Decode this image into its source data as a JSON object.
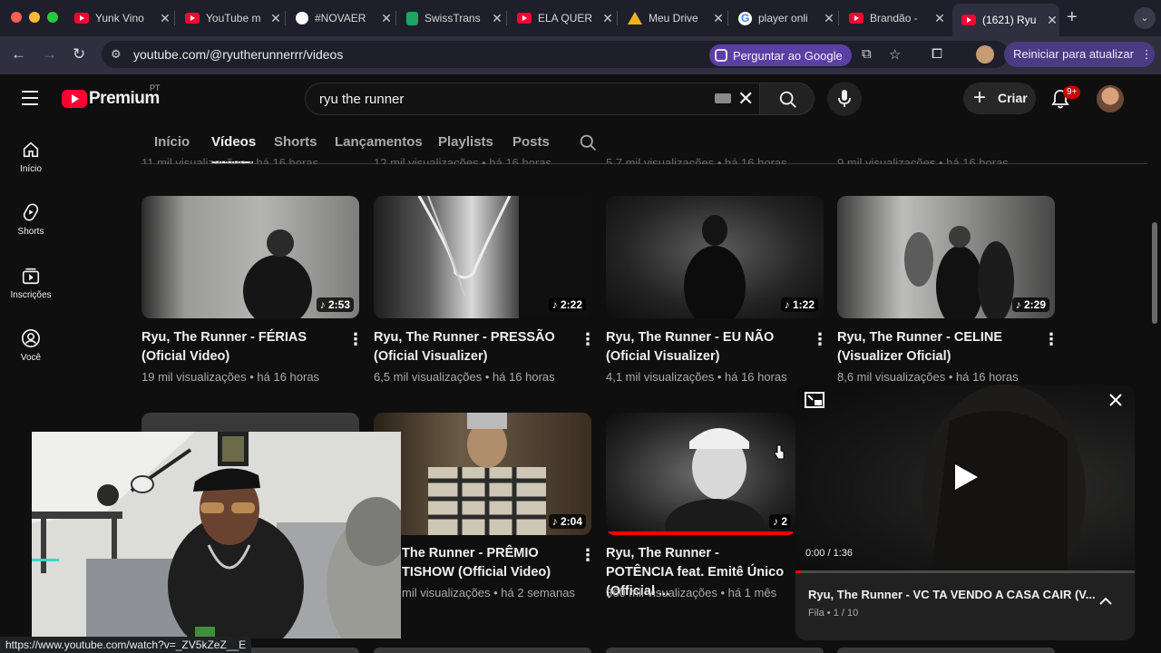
{
  "browser": {
    "tabs": [
      {
        "title": "Yunk Vino",
        "icon": "youtube-icon"
      },
      {
        "title": "YouTube m",
        "icon": "youtube-icon"
      },
      {
        "title": "#NOVAER",
        "icon": "circle-icon"
      },
      {
        "title": "SwissTrans",
        "icon": "sheets-icon"
      },
      {
        "title": "ELA QUER",
        "icon": "youtube-icon"
      },
      {
        "title": "Meu Drive",
        "icon": "drive-icon"
      },
      {
        "title": "player onli",
        "icon": "google-icon"
      },
      {
        "title": "Brandão -",
        "icon": "youtube-icon"
      },
      {
        "title": "(1621) Ryu",
        "icon": "youtube-icon"
      }
    ],
    "url": "youtube.com/@ryutherunnerrr/videos",
    "ask_google": "Perguntar ao Google",
    "relaunch": "Reiniciar para atualizar",
    "status_url": "https://www.youtube.com/watch?v=_ZV5kZeZ__E"
  },
  "youtube": {
    "brand": "Premium",
    "region": "PT",
    "search_query": "ryu the runner",
    "create_label": "Criar",
    "notifications_badge": "9+",
    "rail": [
      {
        "label": "Início",
        "icon": "home-icon"
      },
      {
        "label": "Shorts",
        "icon": "shorts-icon"
      },
      {
        "label": "Inscrições",
        "icon": "subscriptions-icon"
      },
      {
        "label": "Você",
        "icon": "you-icon"
      }
    ],
    "channel_tabs": [
      "Início",
      "Vídeos",
      "Shorts",
      "Lançamentos",
      "Playlists",
      "Posts"
    ],
    "active_tab": "Vídeos",
    "faint_rows": [
      "11 mil visualizações • há 16 horas",
      "12 mil visualizações • há 16 horas",
      "5,7 mil visualizações • há 16 horas",
      "9 mil visualizações • há 16 horas"
    ],
    "videos_row1": [
      {
        "title": "Ryu, The Runner - FÉRIAS (Oficial Video)",
        "duration": "2:53",
        "views": "19 mil visualizações",
        "age": "há 16 horas"
      },
      {
        "title": "Ryu, The Runner - PRESSÃO (Oficial Visualizer)",
        "duration": "2:22",
        "views": "6,5 mil visualizações",
        "age": "há 16 horas"
      },
      {
        "title": "Ryu, The Runner - EU NÃO (Oficial Visualizer)",
        "duration": "1:22",
        "views": "4,1 mil visualizações",
        "age": "há 16 horas"
      },
      {
        "title": "Ryu, The Runner - CELINE (Visualizer Oficial)",
        "duration": "2:29",
        "views": "8,6 mil visualizações",
        "age": "há 16 horas"
      }
    ],
    "videos_row2": [
      {
        "title": "The Runner - PRÊMIO TISHOW (Official Video)",
        "duration": "2:04",
        "meta": "mil visualizações • há 2 semanas"
      },
      {
        "title": "Ryu, The Runner - POTÊNCIA feat. Emitê Único (Official ...",
        "duration": "2",
        "meta": "360 mil visualizações • há 1 mês",
        "watched_fraction": 0.98
      }
    ]
  },
  "miniplayer": {
    "time": "0:00 / 1:36",
    "progress_fraction": 0.02,
    "title": "Ryu, The Runner - VC TA VENDO A CASA CAIR (V...",
    "queue": "Fila • 1 / 10"
  },
  "colors": {
    "accent": "#ff0000",
    "background": "#0f0f0f",
    "purple": "#5b3fa3"
  }
}
